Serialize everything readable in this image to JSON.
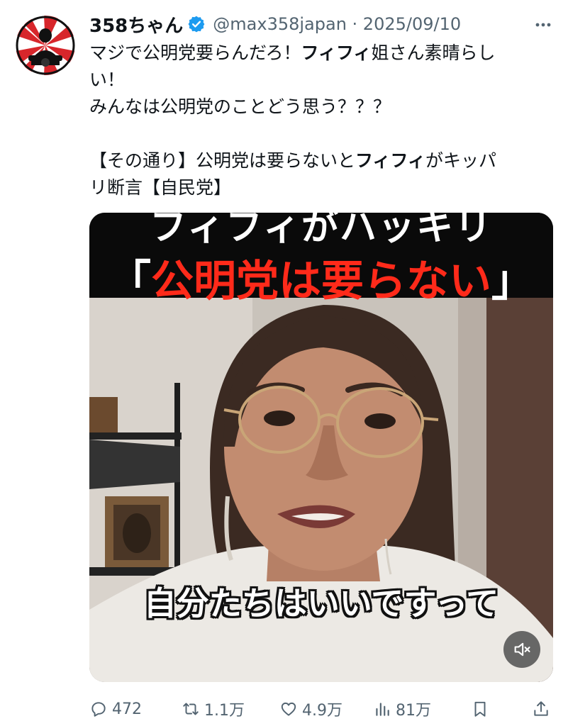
{
  "tweet": {
    "author_name": "358ちゃん",
    "handle_date": "@max358japan · 2025/09/10",
    "text_lines": [
      [
        {
          "t": "マジで公明党要らんだろ！"
        },
        {
          "t": "フィフィ",
          "b": true
        },
        {
          "t": "姐さん素晴らし"
        }
      ],
      [
        {
          "t": "い！"
        }
      ],
      [
        {
          "t": "みんなは公明党のことどう思う？？？"
        }
      ],
      [],
      [
        {
          "t": "【その通り】公明党は要らないと"
        },
        {
          "t": "フィフィ",
          "b": true
        },
        {
          "t": "がキッパ"
        }
      ],
      [
        {
          "t": "リ断言【自民党】"
        }
      ]
    ]
  },
  "media": {
    "banner_line1": "フィフィがハッキリ",
    "banner_open": "「",
    "banner_red": "公明党は要らない",
    "banner_close": "」",
    "caption": "自分たちはいいですって"
  },
  "actions": {
    "replies": "472",
    "reposts": "1.1万",
    "likes": "4.9万",
    "views": "81万"
  },
  "colors": {
    "text": "#0f1419",
    "muted": "#536471",
    "verified": "#1d9bf0",
    "banner_red": "#ff2a1a"
  }
}
